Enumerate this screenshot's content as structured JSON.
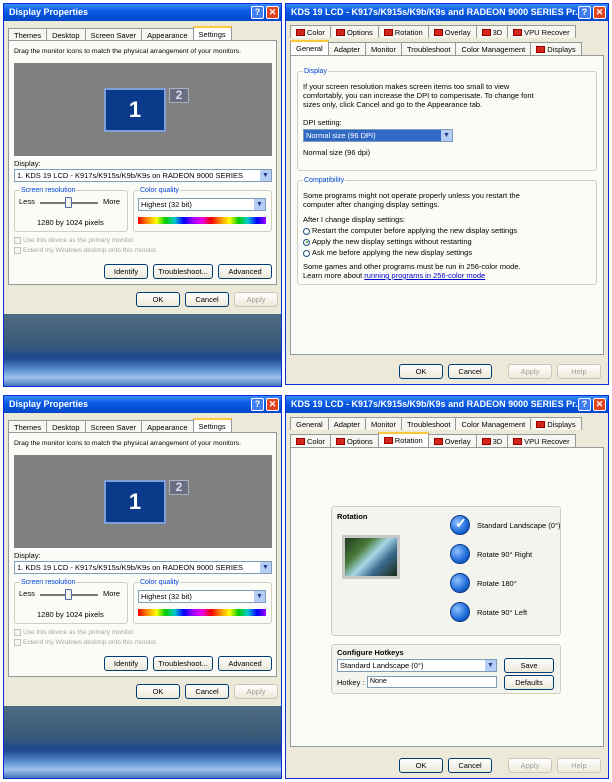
{
  "top": {
    "display_properties": {
      "title": "Display Properties",
      "tabs": [
        "Themes",
        "Desktop",
        "Screen Saver",
        "Appearance",
        "Settings"
      ],
      "active_tab": "Settings",
      "instruction": "Drag the monitor icons to match the physical arrangement of your monitors.",
      "monitor1": "1",
      "monitor2": "2",
      "display_label": "Display:",
      "display_value": "1. KDS 19 LCD - K917s/K915s/K9b/K9s on RADEON 9000 SERIES",
      "resolution_title": "Screen resolution",
      "less": "Less",
      "more": "More",
      "resolution_value": "1280 by 1024 pixels",
      "color_title": "Color quality",
      "color_value": "Highest (32 bit)",
      "primary_check": "Use this device as the primary monitor.",
      "extend_check": "Extend my Windows desktop onto this monitor.",
      "identify": "Identify",
      "troubleshoot": "Troubleshoot...",
      "advanced": "Advanced",
      "ok": "OK",
      "cancel": "Cancel",
      "apply": "Apply"
    },
    "kds_properties": {
      "title": "KDS 19 LCD - K917s/K915s/K9b/K9s and RADEON 9000 SERIES Pr...",
      "tabs_row1": [
        "Color",
        "Options",
        "Rotation",
        "Overlay",
        "3D",
        "VPU Recover"
      ],
      "tabs_row2": [
        "General",
        "Adapter",
        "Monitor",
        "Troubleshoot",
        "Color Management",
        "Displays"
      ],
      "active_tab": "General",
      "display_group": "Display",
      "display_text": "If your screen resolution makes screen items too small to view comfortably, you can increase the DPI to compensate. To change font sizes only, click Cancel and go to the Appearance tab.",
      "dpi_label": "DPI setting:",
      "dpi_value": "Normal size (96 DPI)",
      "dpi_current": "Normal size (96 dpi)",
      "compat_group": "Compatibility",
      "compat_text": "Some programs might not operate properly unless you restart the computer after changing display settings.",
      "after_label": "After I change display settings:",
      "radio1": "Restart the computer before applying the new display settings",
      "radio2": "Apply the new display settings without restarting",
      "radio3": "Ask me before applying the new display settings",
      "games_text": "Some games and other programs must be run in 256-color mode.",
      "learn_prefix": "Learn more about ",
      "learn_link": "running programs in 256-color mode",
      "ok": "OK",
      "cancel": "Cancel",
      "apply": "Apply",
      "help": "Help"
    }
  },
  "bottom": {
    "display_properties": {
      "title": "Display Properties",
      "tabs": [
        "Themes",
        "Desktop",
        "Screen Saver",
        "Appearance",
        "Settings"
      ],
      "instruction": "Drag the monitor icons to match the physical arrangement of your monitors.",
      "monitor1": "1",
      "monitor2": "2",
      "display_label": "Display:",
      "display_value": "1. KDS 19 LCD - K917s/K915s/K9b/K9s on RADEON 9000 SERIES",
      "resolution_title": "Screen resolution",
      "less": "Less",
      "more": "More",
      "resolution_value": "1280 by 1024 pixels",
      "color_title": "Color quality",
      "color_value": "Highest (32 bit)",
      "primary_check": "Use this device as the primary monitor.",
      "extend_check": "Extend my Windows desktop onto this monitor.",
      "identify": "Identify",
      "troubleshoot": "Troubleshoot...",
      "advanced": "Advanced",
      "ok": "OK",
      "cancel": "Cancel",
      "apply": "Apply"
    },
    "kds_properties": {
      "title": "KDS 19 LCD - K917s/K915s/K9b/K9s and RADEON 9000 SERIES Pr...",
      "tabs_row1": [
        "General",
        "Adapter",
        "Monitor",
        "Troubleshoot",
        "Color Management",
        "Displays"
      ],
      "tabs_row2": [
        "Color",
        "Options",
        "Rotation",
        "Overlay",
        "3D",
        "VPU Recover"
      ],
      "active_tab": "Rotation",
      "rotation_label": "Rotation",
      "rot_options": [
        "Standard Landscape (0°)",
        "Rotate 90° Right",
        "Rotate 180°",
        "Rotate 90° Left"
      ],
      "selected_rotation": "Standard Landscape (0°)",
      "hotkeys_title": "Configure Hotkeys",
      "hotkey_select": "Standard Landscape (0°)",
      "hotkey_label": "Hotkey :",
      "hotkey_value": "None",
      "save": "Save",
      "defaults": "Defaults",
      "ok": "OK",
      "cancel": "Cancel",
      "apply": "Apply",
      "help": "Help"
    }
  }
}
